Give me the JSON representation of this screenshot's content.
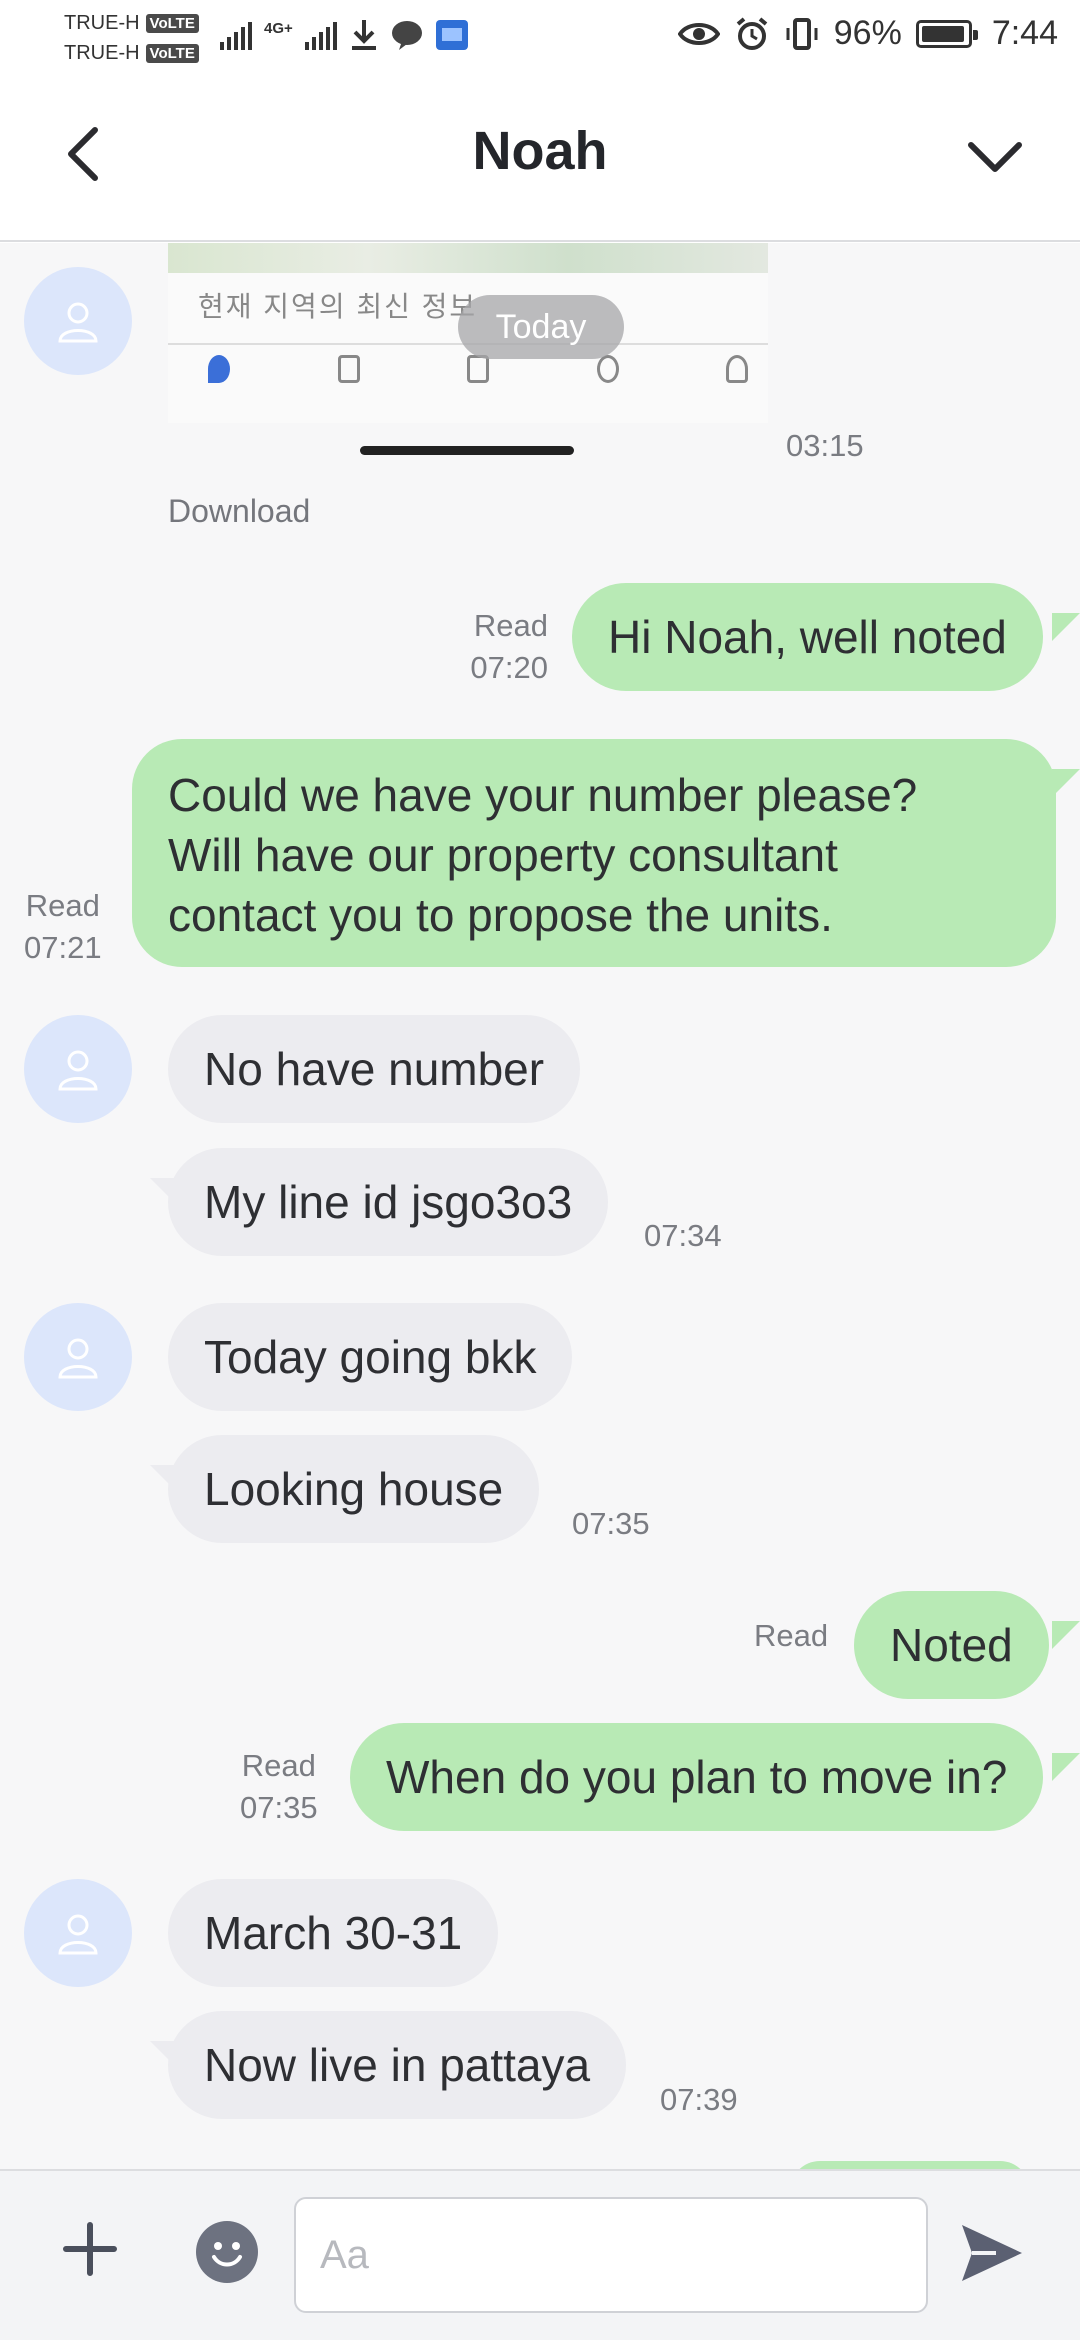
{
  "status_bar": {
    "carrier_1": "TRUE-H",
    "carrier_2": "TRUE-H",
    "volte": "VoLTE",
    "network": "4G+",
    "battery": "96%",
    "time": "7:44"
  },
  "header": {
    "title": "Noah"
  },
  "chat": {
    "date_divider": "Today",
    "image_message": {
      "time": "03:15",
      "download_label": "Download",
      "screenshot_text": "현재 지역의 최신 정보"
    },
    "messages": [
      {
        "direction": "outgoing",
        "text": "Hi Noah, well noted",
        "read": "Read",
        "time": "07:20"
      },
      {
        "direction": "outgoing",
        "lines": [
          "Could we have your number please?",
          "Will have our property consultant",
          "contact you to propose the units."
        ],
        "read": "Read",
        "time": "07:21"
      },
      {
        "direction": "incoming",
        "text": "No have number"
      },
      {
        "direction": "incoming",
        "text": "My line id jsgo3o3",
        "time": "07:34"
      },
      {
        "direction": "incoming",
        "text": "Today going bkk"
      },
      {
        "direction": "incoming",
        "text": "Looking house",
        "time": "07:35"
      },
      {
        "direction": "outgoing",
        "text": "Noted",
        "read": "Read"
      },
      {
        "direction": "outgoing",
        "text": "When do you plan to move in?",
        "read": "Read",
        "time": "07:35"
      },
      {
        "direction": "incoming",
        "text": "March 30-31"
      },
      {
        "direction": "incoming",
        "text": "Now live in pattaya",
        "time": "07:39"
      }
    ]
  },
  "input_bar": {
    "placeholder": "Aa"
  },
  "colors": {
    "outgoing_bubble": "#b8eab5",
    "incoming_bubble": "#ececf0",
    "avatar_bg": "#dce6fb",
    "chat_bg": "#f7f7f8"
  }
}
